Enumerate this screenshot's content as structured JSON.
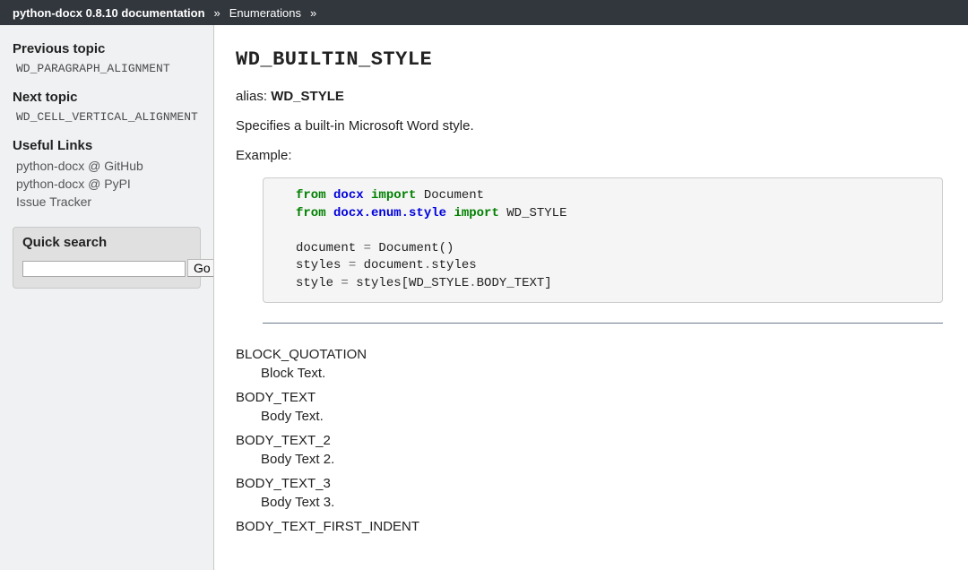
{
  "breadcrumb": {
    "home": "python-docx 0.8.10 documentation",
    "section": "Enumerations",
    "sep": "»"
  },
  "sidebar": {
    "previous_heading": "Previous topic",
    "previous_topic": "WD_PARAGRAPH_ALIGNMENT",
    "next_heading": "Next topic",
    "next_topic": "WD_CELL_VERTICAL_ALIGNMENT",
    "links_heading": "Useful Links",
    "links": [
      "python-docx @ GitHub",
      "python-docx @ PyPI",
      "Issue Tracker"
    ],
    "search_heading": "Quick search",
    "search_button": "Go"
  },
  "main": {
    "title": "WD_BUILTIN_STYLE",
    "alias_prefix": "alias: ",
    "alias_value": "WD_STYLE",
    "description": "Specifies a built-in Microsoft Word style.",
    "example_label": "Example:",
    "code": {
      "l1_kw1": "from",
      "l1_mod": "docx",
      "l1_kw2": "import",
      "l1_rest": " Document",
      "l2_kw1": "from",
      "l2_mod": "docx.enum.style",
      "l2_kw2": "import",
      "l2_rest": " WD_STYLE",
      "l3_a": "document ",
      "l3_eq": "=",
      "l3_b": " Document()",
      "l4_a": "styles ",
      "l4_eq": "=",
      "l4_b": " document",
      "l4_dot": ".",
      "l4_c": "styles",
      "l5_a": "style ",
      "l5_eq": "=",
      "l5_b": " styles[WD_STYLE",
      "l5_dot": ".",
      "l5_c": "BODY_TEXT]"
    },
    "entries": [
      {
        "name": "BLOCK_QUOTATION",
        "desc": "Block Text."
      },
      {
        "name": "BODY_TEXT",
        "desc": "Body Text."
      },
      {
        "name": "BODY_TEXT_2",
        "desc": "Body Text 2."
      },
      {
        "name": "BODY_TEXT_3",
        "desc": "Body Text 3."
      },
      {
        "name": "BODY_TEXT_FIRST_INDENT",
        "desc": ""
      }
    ]
  }
}
